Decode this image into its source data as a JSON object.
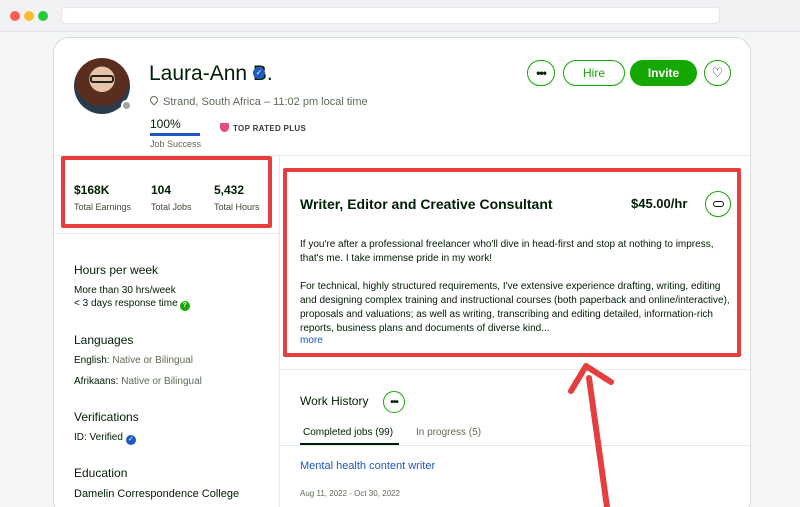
{
  "profile": {
    "name": "Laura-Ann B.",
    "location": "Strand, South Africa – 11:02 pm local time",
    "job_success_value": "100%",
    "job_success_fraction": 1.0,
    "job_success_label": "Job Success",
    "badge": "TOP RATED PLUS"
  },
  "actions": {
    "more_label": "•••",
    "hire_label": "Hire",
    "invite_label": "Invite",
    "favorite_icon": "heart-icon"
  },
  "stats": [
    {
      "value": "$168K",
      "label": "Total Earnings"
    },
    {
      "value": "104",
      "label": "Total Jobs"
    },
    {
      "value": "5,432",
      "label": "Total Hours"
    }
  ],
  "sidebar": {
    "hours_title": "Hours per week",
    "hours_text": "More than 30 hrs/week",
    "response_text": "< 3 days response time",
    "languages_title": "Languages",
    "languages": [
      {
        "lang": "English:",
        "level": "Native or Bilingual"
      },
      {
        "lang": "Afrikaans:",
        "level": "Native or Bilingual"
      }
    ],
    "verifications_title": "Verifications",
    "verification_id": "ID: Verified",
    "education_title": "Education",
    "education_school": "Damelin Correspondence College"
  },
  "overview": {
    "title": "Writer, Editor and Creative Consultant",
    "rate": "$45.00/hr",
    "paragraph_1": "If you're after a professional freelancer who'll dive in head-first and stop at nothing to impress, that's me. I take immense pride in my work!",
    "paragraph_2": "For technical, highly structured requirements, I've extensive experience drafting, writing, editing and designing complex training and instructional courses (both paperback and online/interactive), proposals and valuations; as well as writing, transcribing and editing detailed, information-rich reports, business plans and documents of diverse kind...",
    "more_label": "more"
  },
  "work_history": {
    "title": "Work History",
    "tabs": [
      {
        "label": "Completed jobs (99)"
      },
      {
        "label": "In progress (5)"
      }
    ],
    "first_job_title": "Mental health content writer",
    "first_job_dates": "Aug 11, 2022 - Oct 30, 2022"
  },
  "colors": {
    "brand_green": "#14a800",
    "annotation_red": "#e63e3e",
    "link_blue": "#1f57c3"
  }
}
